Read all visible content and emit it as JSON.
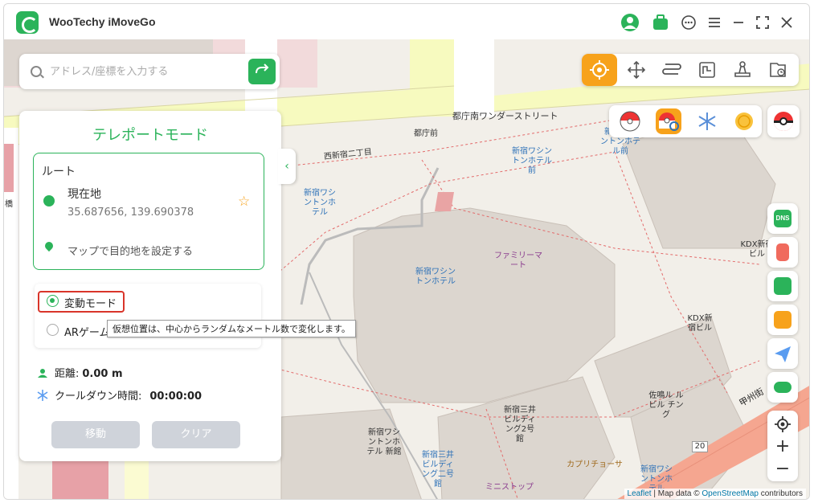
{
  "app": {
    "title": "WooTechy iMoveGo"
  },
  "search": {
    "placeholder": "アドレス/座標を入力する"
  },
  "panel": {
    "title": "テレポートモード",
    "route_label": "ルート",
    "current_location_label": "現在地",
    "current_coords": "35.687656, 139.690378",
    "destination_hint": "マップで目的地を設定する",
    "modes": [
      {
        "label": "変動モード",
        "selected": true
      },
      {
        "label": "ARゲームモード",
        "selected": false
      }
    ],
    "tooltip": "仮想位置は、中心からランダムなメートル数で変化します。",
    "distance_label": "距離:",
    "distance_value": "0.00 m",
    "cooldown_label": "クールダウン時間:",
    "cooldown_value": "00:00:00",
    "move_button": "移動",
    "clear_button": "クリア"
  },
  "map": {
    "labels": {
      "tocho_mae": "都庁前",
      "tocho_minami": "都庁南",
      "wonder_street": "都庁南ワンダーストリート",
      "nishi_2chome": "西新宿二丁目",
      "washington_1": "新宿ワシントンホテル",
      "washington_2": "新宿ワシントンホテル前",
      "washington_3": "新宿ワシ ントンホテル前",
      "washington_4": "新宿ワシ ントンホ テル",
      "familymart": "ファミリーマート",
      "kdx_1": "KDX新宿ビル",
      "kdx_2": "KDX新 宿ビル",
      "sanaruru": "佐鳴ル ルビル チング",
      "mitsui_1": "新宿三井ビルディング2号館",
      "mitsui_2": "新宿三井ビルディング二号館",
      "washington_5": "新宿ワシントンホテル 新館",
      "capricho": "カプリチョーサ",
      "ministop": "ミニストップ",
      "washington_6": "新宿ワシントンホテル",
      "koshu": "甲州街",
      "route_20": "20",
      "side_left": "橋"
    },
    "attribution": {
      "leaflet": "Leaflet",
      "middle": " | Map data © ",
      "osm": "OpenStreetMap",
      "tail": " contributors"
    }
  },
  "colors": {
    "accent": "#2bb35a",
    "active_tool": "#f7a21b",
    "highlight": "#d9352a"
  }
}
